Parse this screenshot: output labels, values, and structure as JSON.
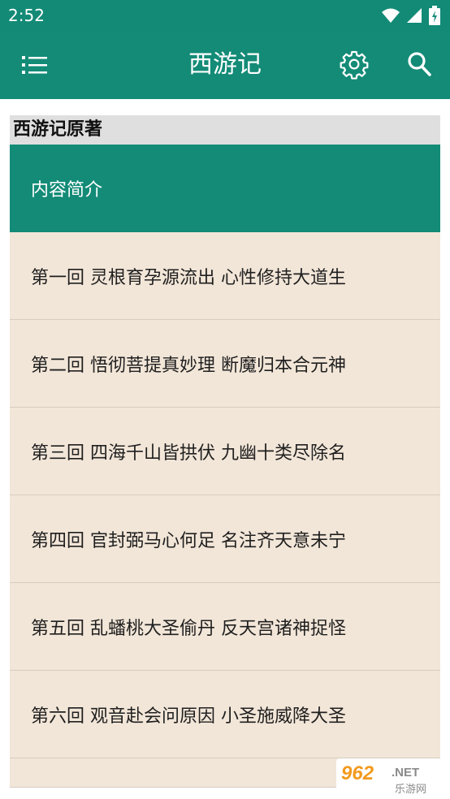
{
  "status_bar": {
    "time": "2:52",
    "icons": [
      "wifi-icon",
      "signal-icon",
      "battery-icon"
    ]
  },
  "app_bar": {
    "title": "西游记",
    "menu_icon": "list-menu-icon",
    "settings_icon": "gear-icon",
    "search_icon": "search-icon"
  },
  "book": {
    "section_title": "西游记原著",
    "items": [
      {
        "label": "内容简介",
        "selected": true
      },
      {
        "label": "第一回 灵根育孕源流出 心性修持大道生"
      },
      {
        "label": "第二回 悟彻菩提真妙理 断魔归本合元神"
      },
      {
        "label": "第三回 四海千山皆拱伏 九幽十类尽除名"
      },
      {
        "label": "第四回 官封弼马心何足 名注齐天意未宁"
      },
      {
        "label": "第五回 乱蟠桃大圣偷丹 反天宫诸神捉怪"
      },
      {
        "label": "第六回 观音赴会问原因 小圣施威降大圣"
      },
      {
        "label": ""
      }
    ]
  },
  "watermark": {
    "brand": "962.NET",
    "subtitle": "乐游网"
  },
  "colors": {
    "primary": "#138b77",
    "list_background": "#f2e6d8",
    "header_background": "#dfdfdf",
    "watermark_orange": "#f39a1e"
  }
}
